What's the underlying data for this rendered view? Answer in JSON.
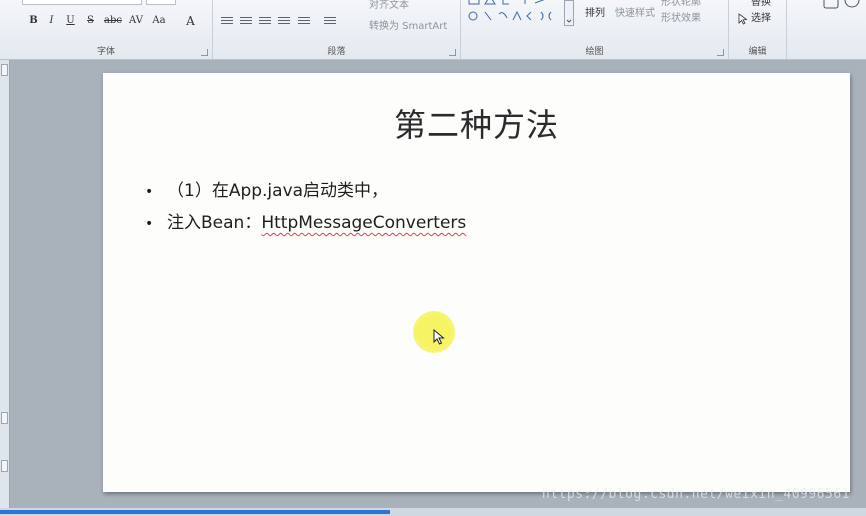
{
  "ribbon": {
    "font_group": {
      "label": "字体",
      "buttons": [
        "B",
        "I",
        "U",
        "S",
        "abc",
        "AV",
        "Aa",
        "A"
      ]
    },
    "paragraph_group": {
      "label": "段落",
      "align_text": "对齐文本",
      "convert_smartart": "转换为 SmartArt"
    },
    "drawing_group": {
      "label": "绘图",
      "arrange": "排列",
      "quick_styles": "快速样式",
      "shape_fill": "形状轮廓",
      "shape_effects": "形状效果"
    },
    "editing_group": {
      "label": "编辑",
      "replace": "替换",
      "select": "选择"
    }
  },
  "slide": {
    "title": "第二种方法",
    "bullets": [
      {
        "marker": "•",
        "text": "（1）在App.java启动类中，"
      },
      {
        "marker": "•",
        "prefix": "注入Bean：",
        "highlighted": "HttpMessageConverters"
      }
    ]
  },
  "watermark": "https://blog.csdn.net/weixin_40996561",
  "colors": {
    "progress_bar": "#2f73d8",
    "cursor_highlight": "#f6f35c",
    "spellcheck_underline": "#e0414a"
  },
  "icons": [
    "cursor-arrow-icon",
    "dropdown-arrow-icon",
    "dialog-launcher-icon"
  ]
}
